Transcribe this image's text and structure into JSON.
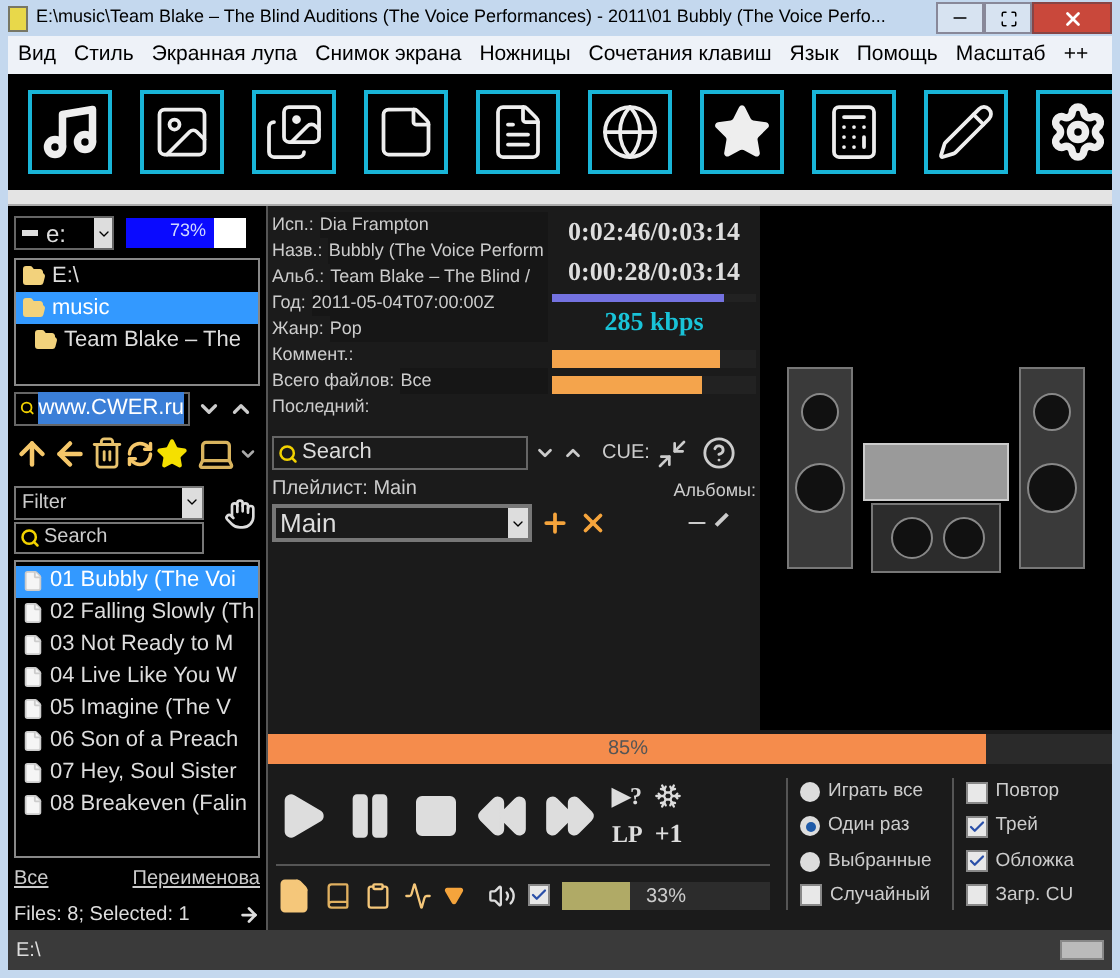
{
  "window": {
    "title": "E:\\music\\Team Blake – The Blind Auditions (The Voice Performances) - 2011\\01 Bubbly (The Voice Perfo..."
  },
  "menu": [
    "Вид",
    "Стиль",
    "Экранная лупа",
    "Снимок экрана",
    "Ножницы",
    "Сочетания клавиш",
    "Язык",
    "Помощь",
    "Масштаб",
    "++"
  ],
  "toolbar": [
    {
      "kind": "music"
    },
    {
      "kind": "picture"
    },
    {
      "kind": "pictures"
    },
    {
      "kind": "notes"
    },
    {
      "kind": "document"
    },
    {
      "kind": "globe"
    },
    {
      "kind": "star"
    },
    {
      "kind": "calculator"
    },
    {
      "kind": "pencil"
    },
    {
      "kind": "settings"
    }
  ],
  "drive": {
    "value": "e:",
    "usage": "73%",
    "level": 0.73
  },
  "folders": [
    {
      "label": "E:\\",
      "selected": false
    },
    {
      "label": "music",
      "selected": true,
      "children": [
        {
          "label": "Team Blake – The",
          "selected": false
        }
      ]
    }
  ],
  "url_field": {
    "value": "www.CWER.ru"
  },
  "filter": {
    "value": "Filter"
  },
  "file_search": {
    "placeholder": "Search"
  },
  "files": [
    {
      "label": "01 Bubbly (The Voi",
      "selected": true
    },
    {
      "label": "02 Falling Slowly (Th",
      "selected": false
    },
    {
      "label": "03 Not Ready to M",
      "selected": false
    },
    {
      "label": "04 Live Like You W",
      "selected": false
    },
    {
      "label": "05 Imagine (The V",
      "selected": false
    },
    {
      "label": "06 Son of a Preach",
      "selected": false
    },
    {
      "label": "07 Hey, Soul Sister",
      "selected": false
    },
    {
      "label": "08 Breakeven (Falin",
      "selected": false
    }
  ],
  "links": [
    "Все",
    "Переименова"
  ],
  "file_status": "Files: 8; Selected: 1",
  "tags": [
    {
      "label": "Исп.:",
      "value": "Dia Frampton"
    },
    {
      "label": "Назв.:",
      "value": "Bubbly (The Voice Perform"
    },
    {
      "label": "Альб.:",
      "value": "Team Blake – The Blind /"
    },
    {
      "label": "Год:",
      "value": "2011-05-04T07:00:00Z"
    },
    {
      "label": "Жанр:",
      "value": "Pop"
    },
    {
      "label": "Коммент.:"
    },
    {
      "label": "Всего файлов:",
      "value": "Все"
    },
    {
      "label": "Последний:"
    }
  ],
  "times": [
    "0:02:46/0:03:14",
    "0:00:28/0:03:14"
  ],
  "position": {
    "level": 0.84
  },
  "bitrate": "285 kbps",
  "meters": [
    {
      "level": 0.82
    },
    {
      "level": 0.74
    }
  ],
  "tag_search": {
    "placeholder": "Search"
  },
  "cue_label": "CUE:",
  "playlist_label": "Плейлист: Main",
  "albums_label": "Альбомы:",
  "playlist_select": {
    "value": "Main"
  },
  "progress": {
    "level": 0.85,
    "reading": "85%"
  },
  "extra_buttons": [
    "▶?",
    "LP",
    "+1"
  ],
  "volume": {
    "checked": true,
    "level": 0.33,
    "reading": "33%"
  },
  "play_modes": [
    {
      "label": "Играть все",
      "selected": false
    },
    {
      "label": "Один раз",
      "selected": true
    },
    {
      "label": "Выбранные",
      "selected": false
    }
  ],
  "shuffle": {
    "label": "Случайный",
    "checked": false
  },
  "options": [
    {
      "label": "Повтор",
      "checked": false
    },
    {
      "label": "Трей",
      "checked": true
    },
    {
      "label": "Обложка",
      "checked": true
    },
    {
      "label": "Загр. CU",
      "checked": false
    }
  ],
  "status_bar": {
    "path": "E:\\"
  }
}
